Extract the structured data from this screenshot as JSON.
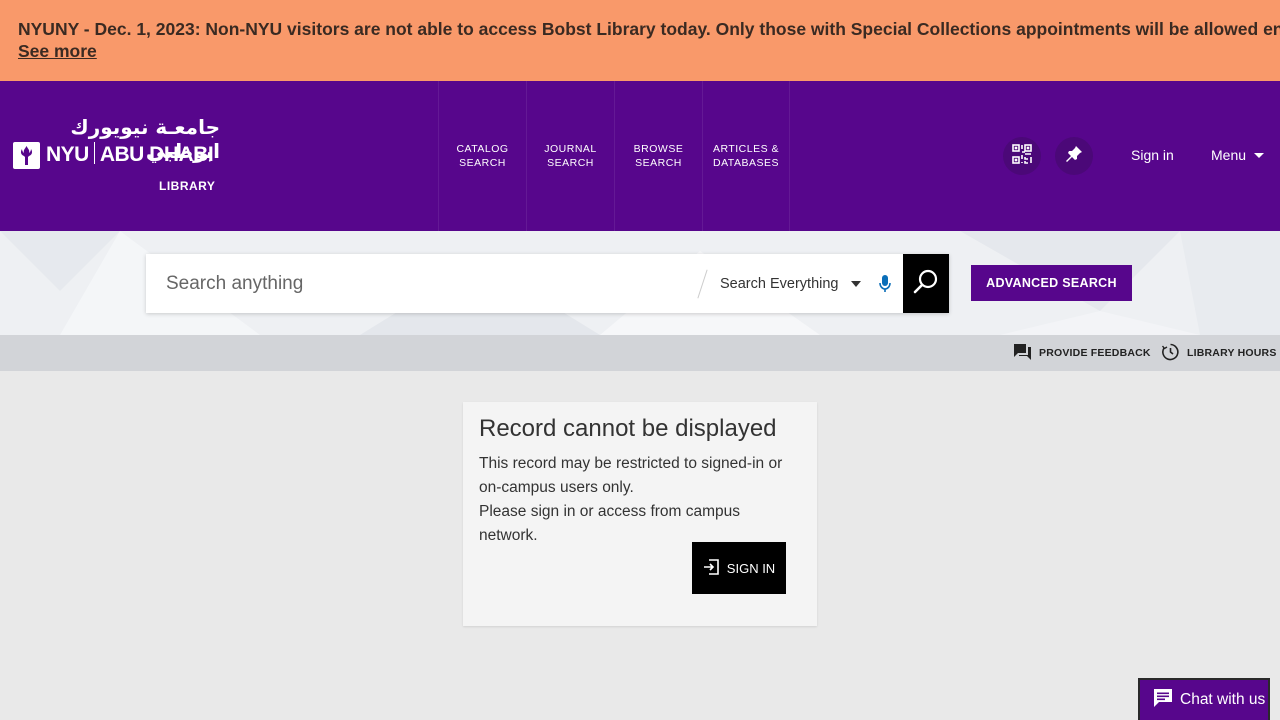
{
  "alert": {
    "message": "NYUNY - Dec. 1, 2023: Non-NYU visitors are not able to access Bobst Library today. Only those with Special Collections appointments will be allowed entry.",
    "link": "See more"
  },
  "header": {
    "logo_arabic": "جامعـة نيويورك ابوظبي",
    "logo_nyu": "NYU",
    "logo_campus": "ABU DHABI",
    "logo_library": "LIBRARY",
    "nav": [
      {
        "line1": "CATALOG",
        "line2": "SEARCH"
      },
      {
        "line1": "JOURNAL",
        "line2": "SEARCH"
      },
      {
        "line1": "BROWSE",
        "line2": "SEARCH"
      },
      {
        "line1": "ARTICLES &",
        "line2": "DATABASES"
      }
    ],
    "sign_in": "Sign in",
    "menu": "Menu"
  },
  "search": {
    "placeholder": "Search anything",
    "scope": "Search Everything",
    "advanced": "ADVANCED SEARCH"
  },
  "utility": {
    "feedback": "PROVIDE FEEDBACK",
    "hours": "LIBRARY HOURS"
  },
  "record": {
    "title": "Record cannot be displayed",
    "line1": "This record may be restricted to signed-in or",
    "line2": "on-campus users only.",
    "line3": "Please sign in or access from campus network.",
    "sign_in": "SIGN IN"
  },
  "chat": {
    "label": "Chat with us"
  },
  "colors": {
    "alert_bg": "#f9996a",
    "brand_purple": "#57068c",
    "search_button": "#000000"
  }
}
